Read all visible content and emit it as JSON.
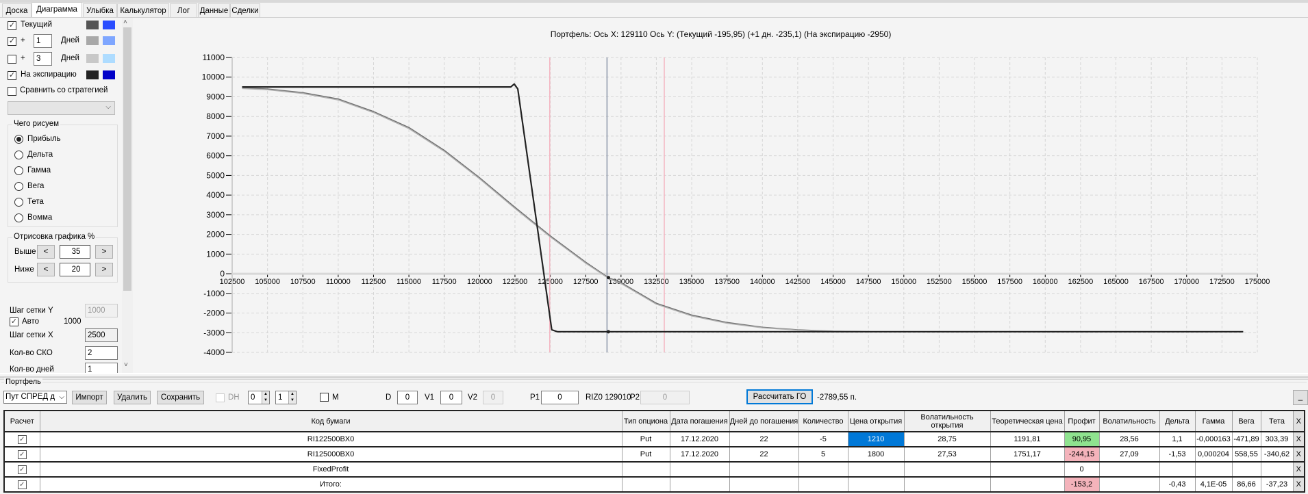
{
  "tabs": [
    "Доска",
    "Диаграмма",
    "Улыбка",
    "Калькулятор",
    "Лог",
    "Данные",
    "Сделки"
  ],
  "active_tab": "Диаграмма",
  "side": {
    "current": {
      "label": "Текущий",
      "checked": true,
      "colors": [
        "#555555",
        "#2a4dff"
      ]
    },
    "plus1": {
      "plus": "+",
      "value": "1",
      "unit": "Дней",
      "checked": true,
      "colors": [
        "#a8a8a8",
        "#7ea6ff"
      ]
    },
    "plus3": {
      "plus": "+",
      "value": "3",
      "unit": "Дней",
      "checked": false,
      "colors": [
        "#c8c8c8",
        "#aedcff"
      ]
    },
    "expiration": {
      "label": "На экспирацию",
      "checked": true,
      "colors": [
        "#222222",
        "#0000c8"
      ]
    },
    "compare": {
      "label": "Сравнить со стратегией",
      "checked": false
    },
    "draw_group": {
      "title": "Чего рисуем",
      "options": [
        "Прибыль",
        "Дельта",
        "Гамма",
        "Вега",
        "Тета",
        "Вомма"
      ],
      "selected": "Прибыль"
    },
    "render_group": {
      "title": "Отрисовка графика %",
      "above_label": "Выше",
      "above": "35",
      "below_label": "Ниже",
      "below": "20",
      "dec": "<",
      "inc": ">"
    },
    "grid_y_label": "Шаг сетки Y",
    "grid_y": "1000",
    "auto_label": "Авто",
    "auto_checked": true,
    "auto_value": "1000",
    "grid_x_label": "Шаг сетки X",
    "grid_x": "2500",
    "sko_label": "Кол-во СКО",
    "sko": "2",
    "days_label": "Кол-во дней",
    "days": "1"
  },
  "chart_title": "Портфель: Ось X: 129110 Ось Y:  (Текущий -195,95)  (+1 дн. -235,1)  (На экспирацию -2950)",
  "chart_data": {
    "type": "line",
    "xlim": [
      102500,
      175000
    ],
    "ylim": [
      -4000,
      11000
    ],
    "x_ticks": [
      102500,
      105000,
      107500,
      110000,
      112500,
      115000,
      117500,
      120000,
      122500,
      125000,
      127500,
      130000,
      132500,
      135000,
      137500,
      140000,
      142500,
      145000,
      147500,
      150000,
      152500,
      155000,
      157500,
      160000,
      162500,
      165000,
      167500,
      170000,
      172500,
      175000
    ],
    "y_ticks": [
      11000,
      10000,
      9000,
      8000,
      7000,
      6000,
      5000,
      4000,
      3000,
      2000,
      1000,
      0,
      -1000,
      -2000,
      -3000,
      -4000
    ],
    "grid": true,
    "series": [
      {
        "key": "expiration",
        "color": "#222222",
        "x": [
          103200,
          122200,
          122450,
          122700,
          125100,
          125500,
          129110,
          174000
        ],
        "y": [
          9500,
          9500,
          9650,
          9400,
          -2850,
          -2950,
          -2950,
          -2950
        ]
      },
      {
        "key": "plus1",
        "color": "#b0b0b0",
        "x": [
          103200,
          105000,
          107500,
          110000,
          112500,
          115000,
          117500,
          120000,
          122500,
          125000,
          127500,
          129110,
          130000,
          132500,
          135000,
          137500,
          140000,
          142500,
          145000,
          147500,
          150000,
          152500
        ],
        "y": [
          9420,
          9360,
          9170,
          8840,
          8200,
          7380,
          6220,
          4830,
          3320,
          1870,
          540,
          -235,
          -500,
          -1550,
          -2150,
          -2520,
          -2750,
          -2870,
          -2930,
          -2950,
          -2950,
          -2950
        ]
      },
      {
        "key": "current",
        "color": "#707070",
        "x": [
          103200,
          105000,
          107500,
          110000,
          112500,
          115000,
          117500,
          120000,
          122500,
          125000,
          127500,
          129110,
          130000,
          132500,
          135000,
          137500,
          140000,
          142500,
          145000,
          147500,
          150000,
          152500
        ],
        "y": [
          9450,
          9400,
          9210,
          8890,
          8250,
          7440,
          6280,
          4885,
          3377,
          1926,
          592,
          -196,
          -450,
          -1500,
          -2100,
          -2480,
          -2720,
          -2850,
          -2920,
          -2945,
          -2950,
          -2950
        ]
      }
    ],
    "vertical_markers": [
      {
        "x": 124960,
        "color": "#f4b6c2"
      },
      {
        "x": 129010,
        "color": "#8a94a8"
      },
      {
        "x": 133060,
        "color": "#f4b6c2"
      }
    ],
    "point_markers": [
      {
        "x": 129110,
        "y": -2950
      },
      {
        "x": 129110,
        "y": -196
      }
    ]
  },
  "portfolio": {
    "title": "Портфель",
    "strategy": "Пут СПРЕД д",
    "import": "Импорт",
    "delete": "Удалить",
    "save": "Сохранить",
    "dh_label": "DH",
    "spin1": "0",
    "spin2": "1",
    "m_label": "M",
    "d_label": "D",
    "d": "0",
    "v1_label": "V1",
    "v1": "0",
    "v2_label": "V2",
    "v2": "0",
    "p1_label": "P1",
    "p1": "0",
    "riz": "RIZ0 129010",
    "p2_label": "P2",
    "p2": "0",
    "calc_go": "Рассчитать ГО",
    "go_value": "-2789,55 п.",
    "minimize": "_"
  },
  "table": {
    "headers": [
      "Расчет",
      "Код бумаги",
      "Тип опциона",
      "Дата погашения",
      "Дней до погашения",
      "Количество",
      "Цена открытия",
      "Волатильность открытия",
      "Теоретическая цена",
      "Профит",
      "Волатильность",
      "Дельта",
      "Гамма",
      "Вега",
      "Тета",
      "X"
    ],
    "rows": [
      {
        "checked": true,
        "cells": [
          "RI122500BX0",
          "Put",
          "17.12.2020",
          "22",
          "-5",
          "1210",
          "28,75",
          "1191,81",
          "90,95",
          "28,56",
          "1,1",
          "-0,000163",
          "-471,89",
          "303,39",
          "X"
        ],
        "profit": "pos",
        "selected_col": 5
      },
      {
        "checked": true,
        "cells": [
          "RI125000BX0",
          "Put",
          "17.12.2020",
          "22",
          "5",
          "1800",
          "27,53",
          "1751,17",
          "-244,15",
          "27,09",
          "-1,53",
          "0,000204",
          "558,55",
          "-340,62",
          "X"
        ]
      },
      {
        "checked": true,
        "cells": [
          "FixedProfit",
          "",
          "",
          "",
          "",
          "",
          "",
          "",
          "0",
          "",
          "",
          "",
          "",
          "",
          "X"
        ],
        "profit": "none"
      },
      {
        "checked": true,
        "cells": [
          "Итого:",
          "",
          "",
          "",
          "",
          "",
          "",
          "",
          "-153,2",
          "",
          "-0,43",
          "4,1E-05",
          "86,66",
          "-37,23",
          "X"
        ]
      }
    ],
    "profit_colors": {
      "pos": "#8fe38f",
      "neg": "#f4b3bb"
    },
    "selected_color": "#0078d7"
  }
}
